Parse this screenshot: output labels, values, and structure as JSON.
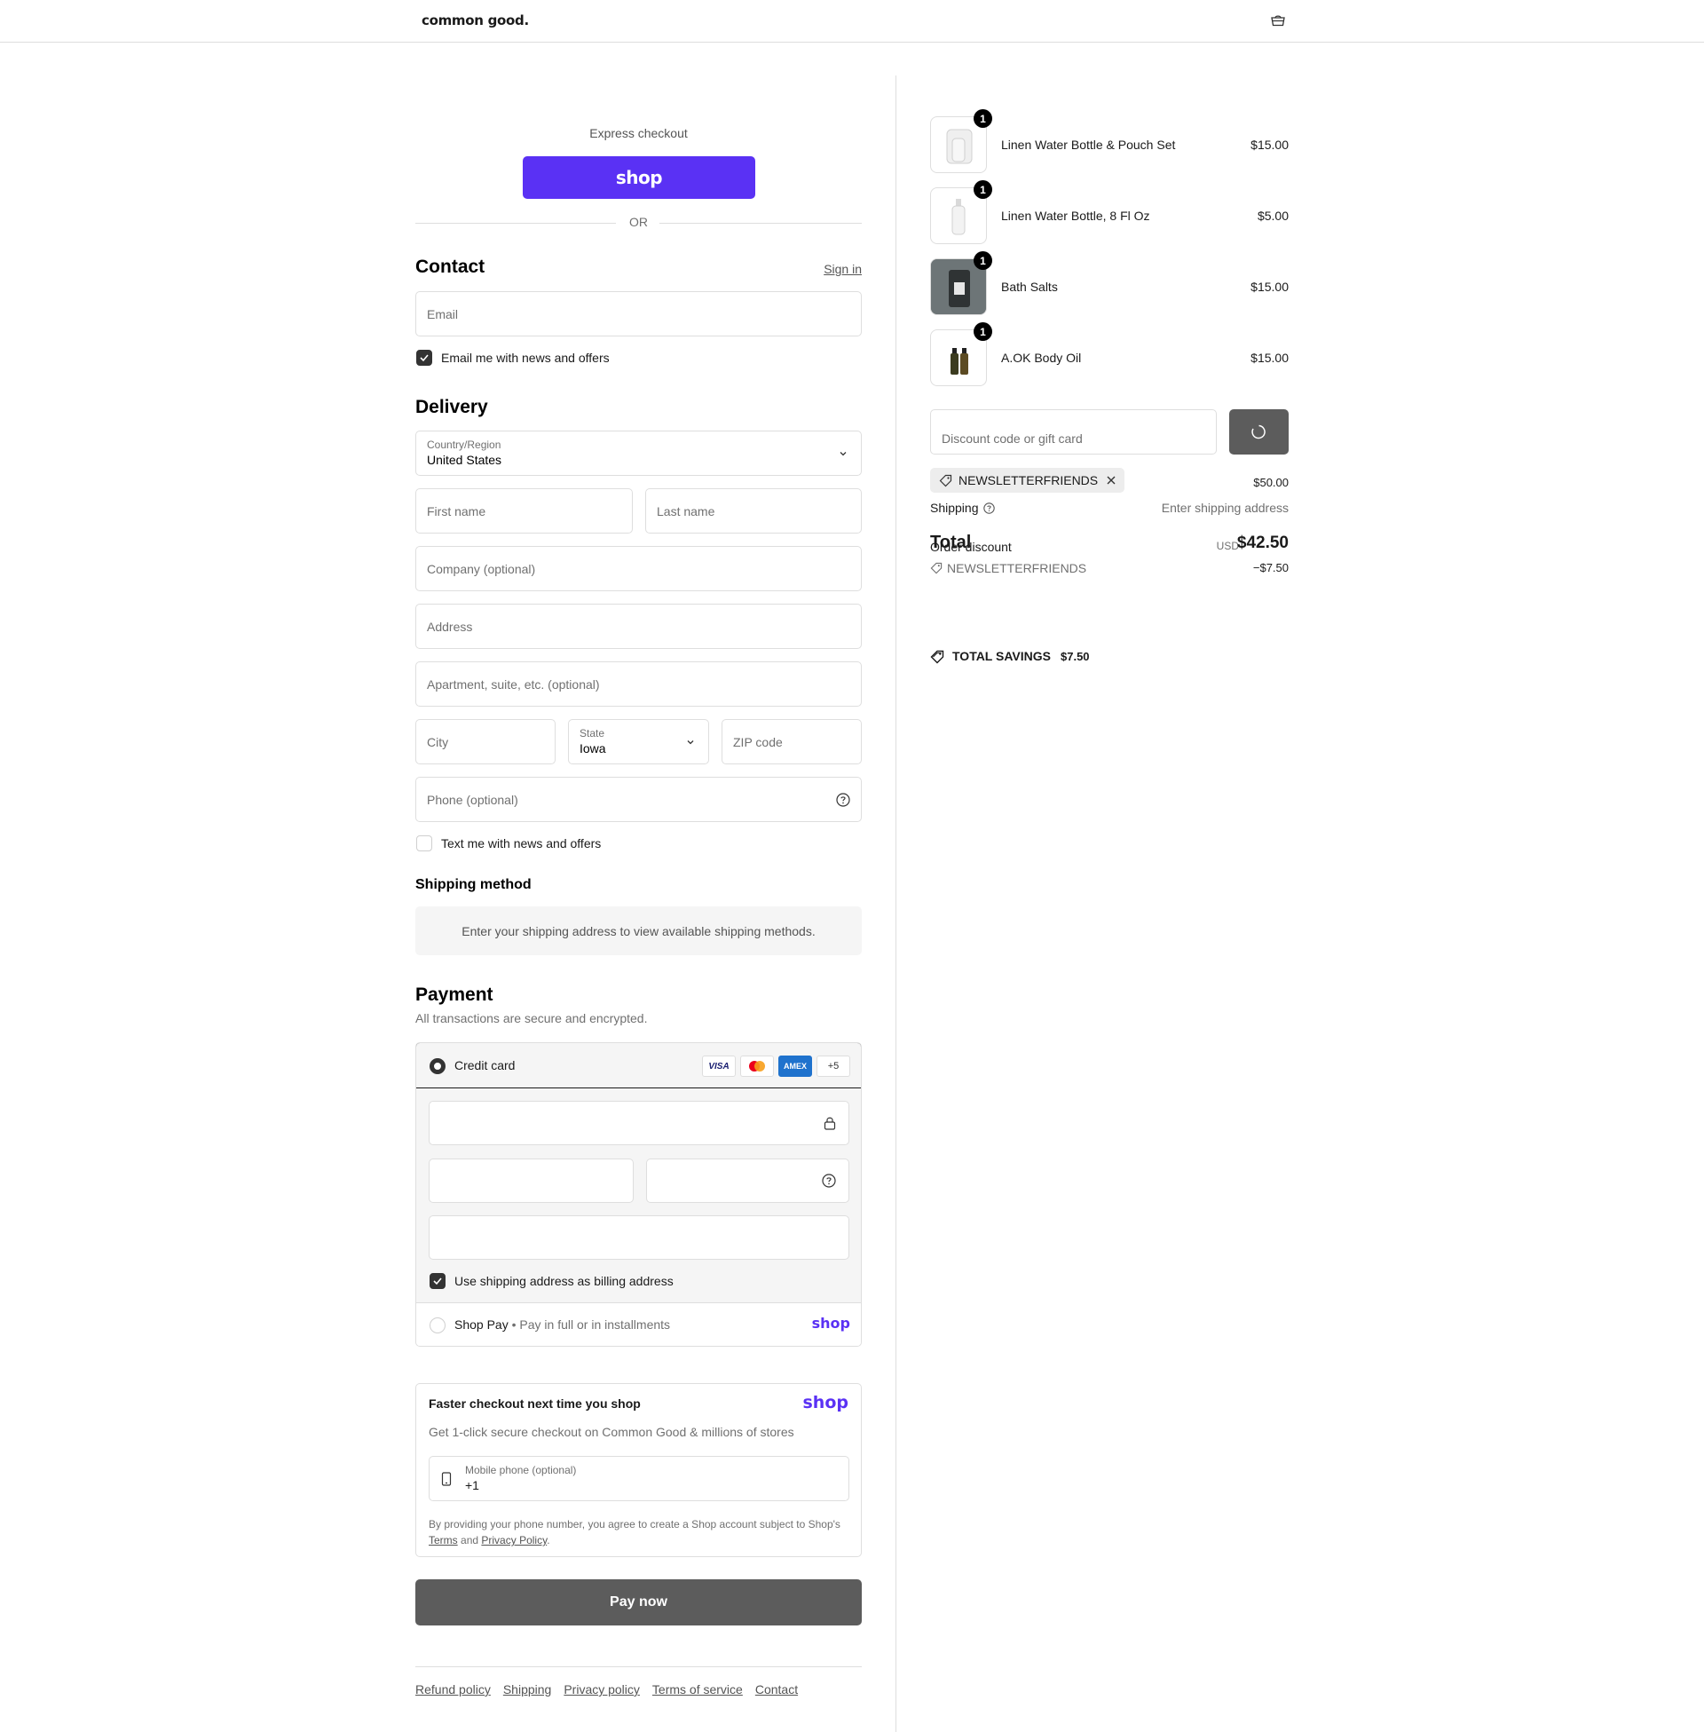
{
  "header": {
    "logo": "common good.",
    "cart_icon": "cart-icon"
  },
  "express": {
    "label": "Express checkout",
    "shop_button": "shop",
    "or": "OR"
  },
  "contact": {
    "title": "Contact",
    "sign_in": "Sign in",
    "email_placeholder": "Email",
    "email_optin_label": "Email me with news and offers",
    "email_optin_checked": true
  },
  "delivery": {
    "title": "Delivery",
    "country_label": "Country/Region",
    "country_value": "United States",
    "first_name_placeholder": "First name",
    "last_name_placeholder": "Last name",
    "company_placeholder": "Company (optional)",
    "address_placeholder": "Address",
    "apartment_placeholder": "Apartment, suite, etc. (optional)",
    "city_placeholder": "City",
    "state_label": "State",
    "state_value": "Iowa",
    "zip_placeholder": "ZIP code",
    "phone_placeholder": "Phone (optional)",
    "text_optin_label": "Text me with news and offers",
    "text_optin_checked": false
  },
  "shipping_method": {
    "title": "Shipping method",
    "message": "Enter your shipping address to view available shipping methods."
  },
  "payment": {
    "title": "Payment",
    "subtitle": "All transactions are secure and encrypted.",
    "credit_card_label": "Credit card",
    "card_brands": [
      "VISA",
      "Mastercard",
      "AMEX",
      "+5"
    ],
    "billing_same_label": "Use shipping address as billing address",
    "billing_same_checked": true,
    "shop_pay_label": "Shop Pay",
    "shop_pay_sub": "Pay in full or in installments",
    "shop_pay_logo": "shop"
  },
  "faster_checkout": {
    "title": "Faster checkout next time you shop",
    "logo": "shop",
    "subtitle": "Get 1-click secure checkout on Common Good & millions of stores",
    "phone_label": "Mobile phone (optional)",
    "phone_value": "+1",
    "legal_prefix": "By providing your phone number, you agree to create a Shop account subject to Shop's",
    "terms": "Terms",
    "and": "and",
    "privacy": "Privacy Policy",
    "period": "."
  },
  "pay_now": "Pay now",
  "footer_links": [
    "Refund policy",
    "Shipping",
    "Privacy policy",
    "Terms of service",
    "Contact"
  ],
  "order": {
    "items": [
      {
        "name": "Linen Water Bottle & Pouch Set",
        "price": "$15.00",
        "qty": "1"
      },
      {
        "name": "Linen Water Bottle, 8 Fl Oz",
        "price": "$5.00",
        "qty": "1"
      },
      {
        "name": "Bath Salts",
        "price": "$15.00",
        "qty": "1"
      },
      {
        "name": "A.OK Body Oil",
        "price": "$15.00",
        "qty": "1"
      }
    ],
    "discount_placeholder": "Discount code or gift card",
    "applied_code": "NEWSLETTERFRIENDS",
    "subtotal_value": "$50.00",
    "shipping_label": "Shipping",
    "shipping_value": "Enter shipping address",
    "total_label": "Total",
    "order_discount_label": "Order discount",
    "currency": "USD",
    "total_value": "$42.50",
    "discount_code_line": "NEWSLETTERFRIENDS",
    "discount_amount": "−$7.50",
    "total_savings_label": "TOTAL SAVINGS",
    "total_savings_value": "$7.50"
  },
  "colors": {
    "shop_purple": "#5a31f4",
    "button_gray": "#5c5c5c",
    "border": "#dedede"
  }
}
